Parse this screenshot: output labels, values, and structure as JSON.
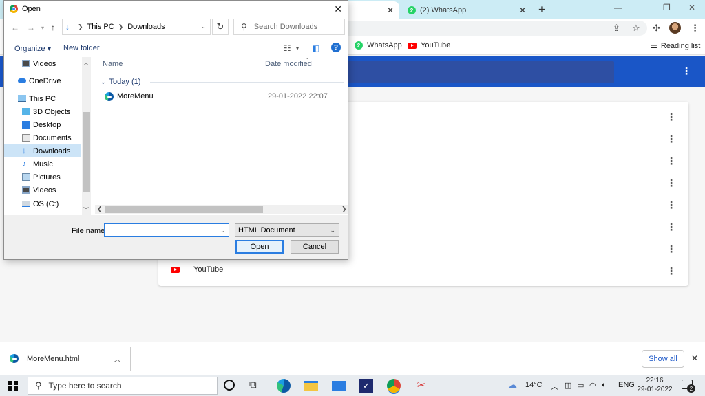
{
  "browser": {
    "tabs": [
      {
        "label": ""
      },
      {
        "label": "(2) WhatsApp",
        "badge": "2"
      }
    ],
    "bookmarks": [
      {
        "label": "WhatsApp",
        "badge": "2"
      },
      {
        "label": "YouTube"
      }
    ],
    "reading_list": "Reading list",
    "list_last_item": "YouTube"
  },
  "downloads": {
    "file": "MoreMenu.html",
    "show_all": "Show all"
  },
  "taskbar": {
    "search_placeholder": "Type here to search",
    "weather": "14°C",
    "language": "ENG",
    "time": "22:16",
    "date": "29-01-2022",
    "notification_count": "2"
  },
  "dialog": {
    "title": "Open",
    "breadcrumb": [
      "This PC",
      "Downloads"
    ],
    "search_placeholder": "Search Downloads",
    "organize": "Organize",
    "new_folder": "New folder",
    "nav_items": [
      {
        "label": "Videos",
        "icon": "videos-icon"
      },
      {
        "label": "OneDrive",
        "icon": "onedrive-icon"
      },
      {
        "label": "This PC",
        "icon": "this-pc-icon"
      },
      {
        "label": "3D Objects",
        "icon": "3d-objects-icon"
      },
      {
        "label": "Desktop",
        "icon": "desktop-icon"
      },
      {
        "label": "Documents",
        "icon": "documents-icon"
      },
      {
        "label": "Downloads",
        "icon": "downloads-icon",
        "selected": true
      },
      {
        "label": "Music",
        "icon": "music-icon"
      },
      {
        "label": "Pictures",
        "icon": "pictures-icon"
      },
      {
        "label": "Videos",
        "icon": "videos-icon"
      },
      {
        "label": "OS (C:)",
        "icon": "drive-icon"
      }
    ],
    "columns": {
      "name": "Name",
      "date": "Date modified"
    },
    "group": "Today (1)",
    "files": [
      {
        "name": "MoreMenu",
        "date": "29-01-2022 22:07"
      }
    ],
    "file_name_label": "File name:",
    "file_name_value": "",
    "file_type": "HTML Document",
    "open_label": "Open",
    "cancel_label": "Cancel"
  },
  "colors": {
    "accent_blue": "#1a56c7",
    "selection": "#cce4f7",
    "tab_strip": "#ccecf5"
  }
}
